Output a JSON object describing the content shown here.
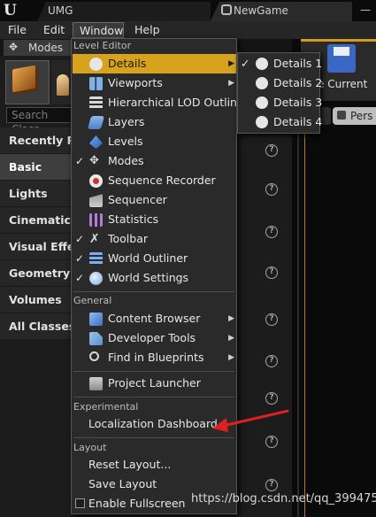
{
  "titlebar": {
    "logo": "U",
    "tab_umg": "UMG",
    "tab_newgame": "NewGame",
    "minimize": "—"
  },
  "menubar": {
    "file": "File",
    "edit": "Edit",
    "window": "Window",
    "help": "Help"
  },
  "left_panel": {
    "modes_tab": "Modes",
    "search_placeholder": "Search Class",
    "categories": [
      "Recently Pla",
      "Basic",
      "Lights",
      "Cinematic",
      "Visual Effect",
      "Geometry",
      "Volumes",
      "All Classes"
    ],
    "active_category": "Basic",
    "help_glyph": "?"
  },
  "right_area": {
    "save_current": "ve Current",
    "perspective": "Pers"
  },
  "window_menu": {
    "sections": {
      "level_editor": "Level Editor",
      "general": "General",
      "experimental": "Experimental",
      "layout": "Layout"
    },
    "level_editor_items": [
      {
        "label": "Details",
        "icon": "details-icon",
        "checked": false,
        "submenu": true,
        "highlighted": true
      },
      {
        "label": "Viewports",
        "icon": "viewports-icon",
        "checked": false,
        "submenu": true
      },
      {
        "label": "Hierarchical LOD Outliner",
        "icon": "hlod-icon",
        "checked": false,
        "submenu": false
      },
      {
        "label": "Layers",
        "icon": "layers-icon",
        "checked": false,
        "submenu": false
      },
      {
        "label": "Levels",
        "icon": "levels-icon",
        "checked": false,
        "submenu": false
      },
      {
        "label": "Modes",
        "icon": "modes-icon",
        "checked": true,
        "submenu": false
      },
      {
        "label": "Sequence Recorder",
        "icon": "record-icon",
        "checked": false,
        "submenu": false
      },
      {
        "label": "Sequencer",
        "icon": "sequencer-icon",
        "checked": false,
        "submenu": false
      },
      {
        "label": "Statistics",
        "icon": "statistics-icon",
        "checked": false,
        "submenu": false
      },
      {
        "label": "Toolbar",
        "icon": "toolbar-icon",
        "checked": true,
        "submenu": false
      },
      {
        "label": "World Outliner",
        "icon": "outliner-icon",
        "checked": true,
        "submenu": false
      },
      {
        "label": "World Settings",
        "icon": "world-settings-icon",
        "checked": true,
        "submenu": false
      }
    ],
    "general_items": [
      {
        "label": "Content Browser",
        "icon": "content-browser-icon",
        "submenu": true
      },
      {
        "label": "Developer Tools",
        "icon": "developer-tools-icon",
        "submenu": true
      },
      {
        "label": "Find in Blueprints",
        "icon": "find-icon",
        "submenu": true
      }
    ],
    "project_launcher": "Project Launcher",
    "experimental_items": [
      "Localization Dashboard"
    ],
    "layout_items": [
      "Reset Layout...",
      "Save Layout",
      "Enable Fullscreen"
    ],
    "check_glyph": "✓",
    "arrow_glyph": "▶"
  },
  "details_submenu": {
    "items": [
      {
        "label": "Details 1",
        "checked": true
      },
      {
        "label": "Details 2",
        "checked": false
      },
      {
        "label": "Details 3",
        "checked": false
      },
      {
        "label": "Details 4",
        "checked": false
      }
    ]
  },
  "colors": {
    "highlight": "#d8a21c",
    "annotation_arrow": "#e02020",
    "accent_orange": "#d39b1f"
  },
  "watermark": "https://blog.csdn.net/qq_39947564"
}
